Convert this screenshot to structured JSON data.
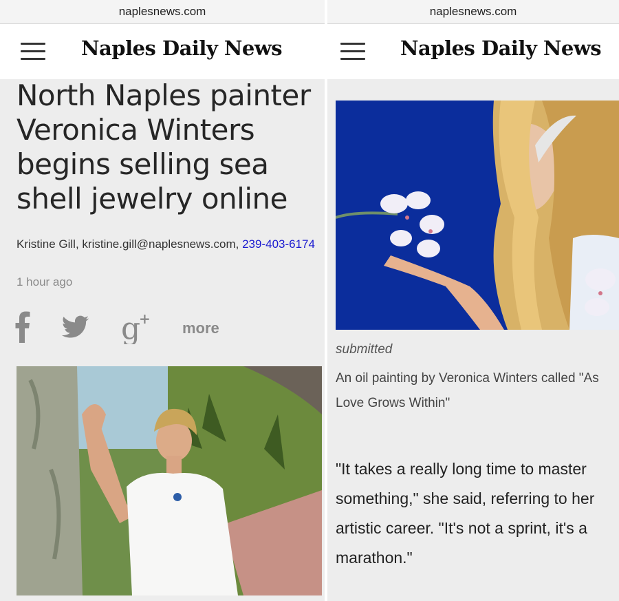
{
  "left": {
    "url": "naplesnews.com",
    "masthead": "Naples Daily News",
    "headline": "North Naples painter Veronica Winters begins selling sea shell jewelry online",
    "byline": {
      "author": "Kristine Gill, kristine.gill@naplesnews.com, ",
      "phone": "239-403-6174"
    },
    "timestamp": "1 hour ago",
    "share": {
      "icons": [
        "facebook-icon",
        "twitter-icon",
        "google-plus-icon"
      ],
      "more_label": "more"
    }
  },
  "right": {
    "url": "naplesnews.com",
    "masthead": "Naples Daily News",
    "caption_credit": "submitted",
    "caption_lines": [
      "An oil painting by Veronica Winters called \"As",
      "Love Grows Within\""
    ],
    "body_lines": [
      "\"It takes a really long time to master",
      "something,\" she said, referring to her",
      "artistic career. \"It's not a sprint, it's a",
      "marathon.\""
    ]
  },
  "colors": {
    "link": "#1a1ad0",
    "page_bg": "#ededed",
    "painting_bg": "#0b2d9c"
  }
}
